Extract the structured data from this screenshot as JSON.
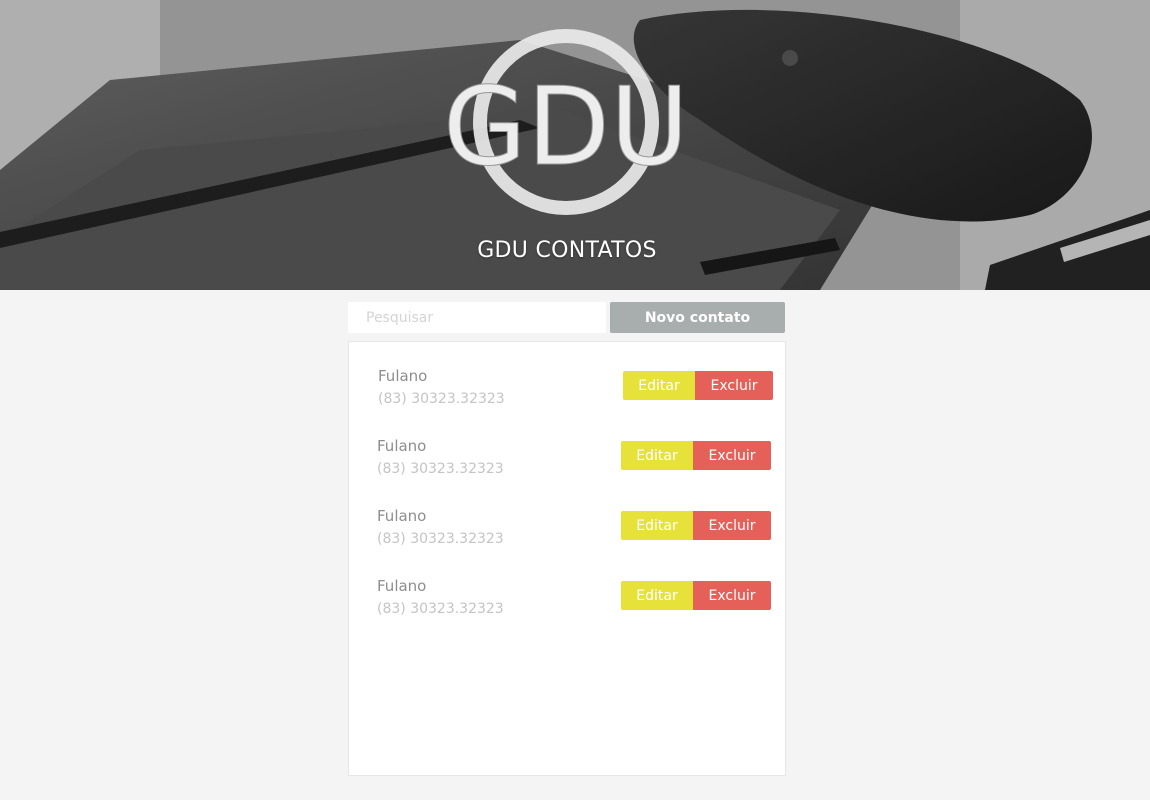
{
  "header": {
    "logo_text": "GDU",
    "title": "GDU CONTATOS"
  },
  "toolbar": {
    "search_placeholder": "Pesquisar",
    "search_value": "",
    "new_contact_label": "Novo contato"
  },
  "contacts": [
    {
      "name": "Fulano",
      "phone": "(83) 30323.32323",
      "edit_label": "Editar",
      "delete_label": "Excluir"
    },
    {
      "name": "Fulano",
      "phone": "(83) 30323.32323",
      "edit_label": "Editar",
      "delete_label": "Excluir"
    },
    {
      "name": "Fulano",
      "phone": "(83) 30323.32323",
      "edit_label": "Editar",
      "delete_label": "Excluir"
    },
    {
      "name": "Fulano",
      "phone": "(83) 30323.32323",
      "edit_label": "Editar",
      "delete_label": "Excluir"
    }
  ],
  "colors": {
    "page_background": "#f4f4f4",
    "new_contact_button": "#a8adad",
    "edit_button": "#e6e23a",
    "delete_button": "#e6605a",
    "name_text": "#8e8e8e",
    "phone_text": "#c4c4c4"
  },
  "icons": {
    "header_background": "desk-photo-image",
    "logo": "gdu-logo"
  }
}
